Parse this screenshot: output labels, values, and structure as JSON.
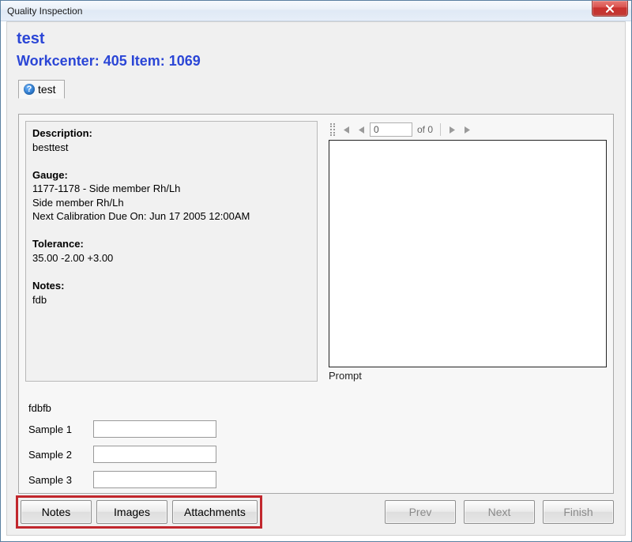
{
  "window": {
    "title": "Quality Inspection"
  },
  "header": {
    "title": "test",
    "subtitle": "Workcenter: 405 Item: 1069"
  },
  "tab": {
    "label": "test",
    "icon_glyph": "?"
  },
  "description": {
    "description_label": "Description:",
    "description_value": "besttest",
    "gauge_label": "Gauge:",
    "gauge_line1": "1177-1178 - Side member Rh/Lh",
    "gauge_line2": "Side member Rh/Lh",
    "gauge_line3": "Next Calibration Due On: Jun 17 2005 12:00AM",
    "tolerance_label": "Tolerance:",
    "tolerance_value": "35.00 -2.00 +3.00",
    "notes_label": "Notes:",
    "notes_value": "fdb"
  },
  "pager": {
    "page_value": "0",
    "of_text": "of 0"
  },
  "prompt": {
    "label": "Prompt"
  },
  "extra_text": "fdbfb",
  "samples": [
    {
      "label": "Sample 1",
      "value": ""
    },
    {
      "label": "Sample 2",
      "value": ""
    },
    {
      "label": "Sample 3",
      "value": ""
    }
  ],
  "buttons": {
    "notes": "Notes",
    "images": "Images",
    "attachments": "Attachments",
    "prev": "Prev",
    "next": "Next",
    "finish": "Finish"
  }
}
